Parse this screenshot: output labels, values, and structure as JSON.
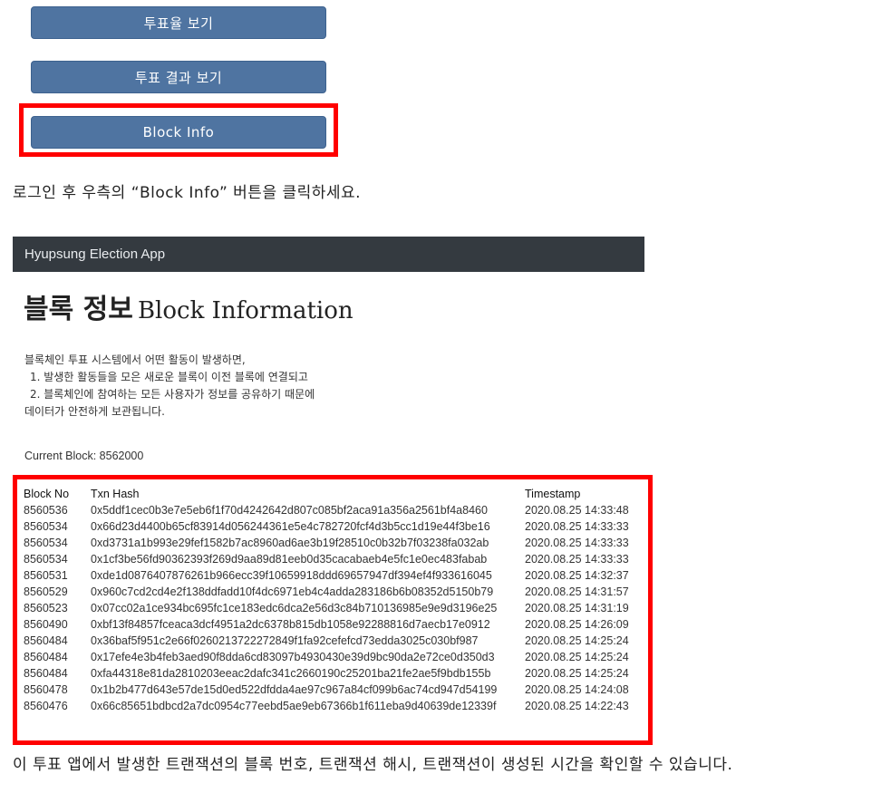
{
  "buttons": {
    "vote_rate": "투표율 보기",
    "vote_result": "투표 결과 보기",
    "block_info": "Block Info"
  },
  "captions": {
    "top": "로그인 후 우측의 “Block Info” 버튼을 클릭하세요.",
    "bottom": "이 투표 앱에서 발생한 트랜잭션의 블록 번호, 트랜잭션 해시, 트랜잭션이 생성된 시간을 확인할 수 있습니다."
  },
  "app": {
    "brand": "Hyupsung Election App",
    "title_ko": "블록 정보",
    "title_en": "Block Information",
    "description": [
      "블록체인 투표 시스템에서 어떤 활동이 발생하면,",
      "1. 발생한 활동들을 모은 새로운 블록이 이전 블록에 연결되고",
      "2. 블록체인에 참여하는 모든 사용자가 정보를 공유하기 때문에",
      "데이터가 안전하게 보관됩니다."
    ],
    "current_block": "Current Block: 8562000"
  },
  "table": {
    "headers": [
      "Block No",
      "Txn Hash",
      "Timestamp"
    ],
    "rows": [
      [
        "8560536",
        "0x5ddf1cec0b3e7e5eb6f1f70d4242642d807c085bf2aca91a356a2561bf4a8460",
        "2020.08.25 14:33:48"
      ],
      [
        "8560534",
        "0x66d23d4400b65cf83914d056244361e5e4c782720fcf4d3b5cc1d19e44f3be16",
        "2020.08.25 14:33:33"
      ],
      [
        "8560534",
        "0xd3731a1b993e29fef1582b7ac8960ad6ae3b19f28510c0b32b7f03238fa032ab",
        "2020.08.25 14:33:33"
      ],
      [
        "8560534",
        "0x1cf3be56fd90362393f269d9aa89d81eeb0d35cacabaeb4e5fc1e0ec483fabab",
        "2020.08.25 14:33:33"
      ],
      [
        "8560531",
        "0xde1d0876407876261b966ecc39f10659918ddd69657947df394ef4f933616045",
        "2020.08.25 14:32:37"
      ],
      [
        "8560529",
        "0x960c7cd2cd4e2f138ddfadd10f4dc6971eb4c4adda283186b6b08352d5150b79",
        "2020.08.25 14:31:57"
      ],
      [
        "8560523",
        "0x07cc02a1ce934bc695fc1ce183edc6dca2e56d3c84b710136985e9e9d3196e25",
        "2020.08.25 14:31:19"
      ],
      [
        "8560490",
        "0xbf13f84857fceaca3dcf4951a2dc6378b815db1058e92288816d7aecb17e0912",
        "2020.08.25 14:26:09"
      ],
      [
        "8560484",
        "0x36baf5f951c2e66f0260213722272849f1fa92cefefcd73edda3025c030bf987",
        "2020.08.25 14:25:24"
      ],
      [
        "8560484",
        "0x17efe4e3b4feb3aed90f8dda6cd83097b4930430e39d9bc90da2e72ce0d350d3",
        "2020.08.25 14:25:24"
      ],
      [
        "8560484",
        "0xfa44318e81da2810203eeac2dafc341c2660190c25201ba21fe2ae5f9bdb155b",
        "2020.08.25 14:25:24"
      ],
      [
        "8560478",
        "0x1b2b477d643e57de15d0ed522dfdda4ae97c967a84cf099b6ac74cd947d54199",
        "2020.08.25 14:24:08"
      ],
      [
        "8560476",
        "0x66c85651bdbcd2a7dc0954c77eebd5ae9eb67366b1f611eba9d40639de12339f",
        "2020.08.25 14:22:43"
      ]
    ]
  },
  "highlight_color": "#ff0000"
}
